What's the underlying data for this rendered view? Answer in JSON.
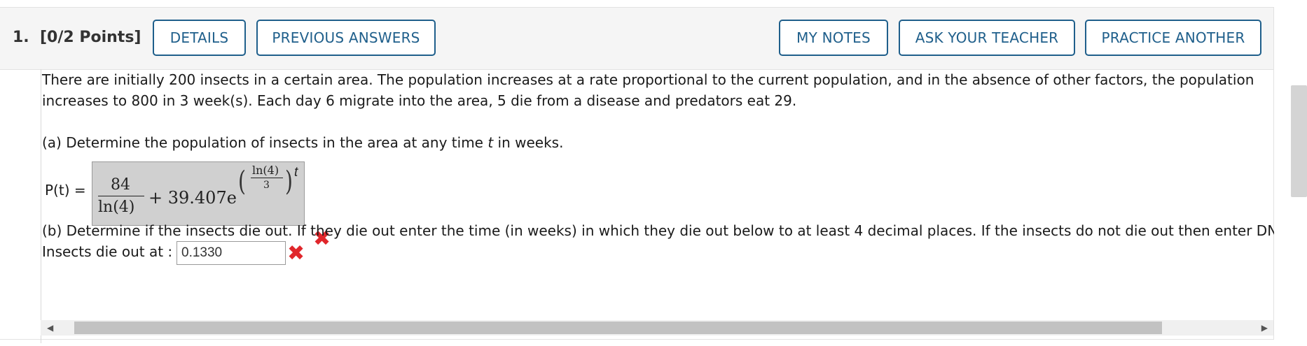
{
  "question": {
    "number": "1.",
    "points": "[0/2 Points]",
    "buttons": {
      "details": "DETAILS",
      "previous_answers": "PREVIOUS ANSWERS",
      "my_notes": "MY NOTES",
      "ask_teacher": "ASK YOUR TEACHER",
      "practice_another": "PRACTICE ANOTHER"
    }
  },
  "problem": {
    "line1": "There are initially 200 insects in a certain area. The population increases at a rate proportional to the current population, and in the absence of other factors, the population",
    "line2": "increases to 800 in 3 week(s). Each day 6 migrate into the area, 5 die from a disease and predators eat 29."
  },
  "part_a": {
    "prompt_before": "(a) Determine the population of insects in the area at any time ",
    "prompt_var": "t",
    "prompt_after": " in weeks.",
    "label": "P(t) =",
    "answer": {
      "frac_num": "84",
      "frac_den": "ln(4)",
      "plus_term": "+ 39.407e",
      "exp_num": "ln(4)",
      "exp_den": "3",
      "exp_var": "t"
    },
    "status": "incorrect"
  },
  "part_b": {
    "prompt": "(b) Determine if the insects die out. If they die out enter the time (in weeks) in which they die out below to at least 4 decimal places. If the insects do not die out then enter DNE",
    "label": "Insects die out at :",
    "input_value": "0.1330",
    "status": "incorrect"
  },
  "icons": {
    "incorrect": "x-mark-icon",
    "scroll_left": "left-arrow-icon",
    "scroll_right": "right-arrow-icon"
  },
  "colors": {
    "button_border": "#1f5f8b",
    "incorrect": "#e0262b",
    "math_bg": "#d0d0d0"
  }
}
